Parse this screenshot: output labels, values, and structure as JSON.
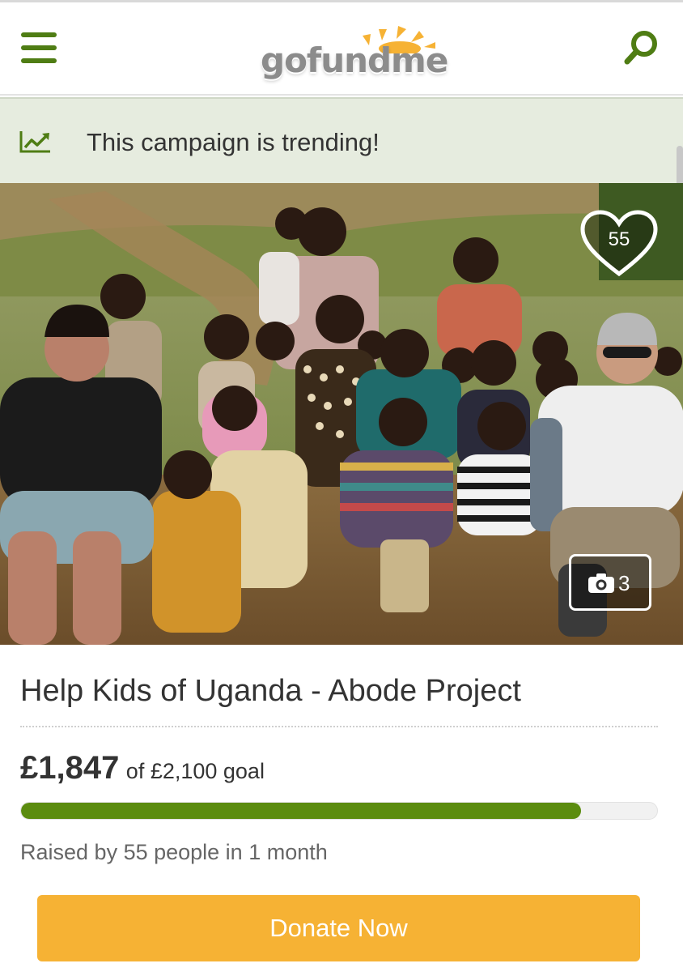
{
  "header": {
    "logo_text": "gofundme",
    "menu_icon": "hamburger-menu-icon",
    "search_icon": "search-icon",
    "brand_color": "#4f7d14"
  },
  "banner": {
    "icon": "trending-chart-icon",
    "text": "This campaign is trending!"
  },
  "hero": {
    "icon_heart": "heart-icon",
    "heart_count": "55",
    "icon_camera": "camera-icon",
    "photo_count": "3"
  },
  "campaign": {
    "title": "Help Kids of Uganda - Abode Project",
    "raised_amount": "£1,847",
    "goal_text": "of £2,100 goal",
    "progress_fraction": 0.88,
    "raised_by": "Raised by 55 people in 1 month",
    "progress_color": "#5b8c0f"
  },
  "cta": {
    "donate_label": "Donate Now",
    "color": "#f6b234"
  }
}
